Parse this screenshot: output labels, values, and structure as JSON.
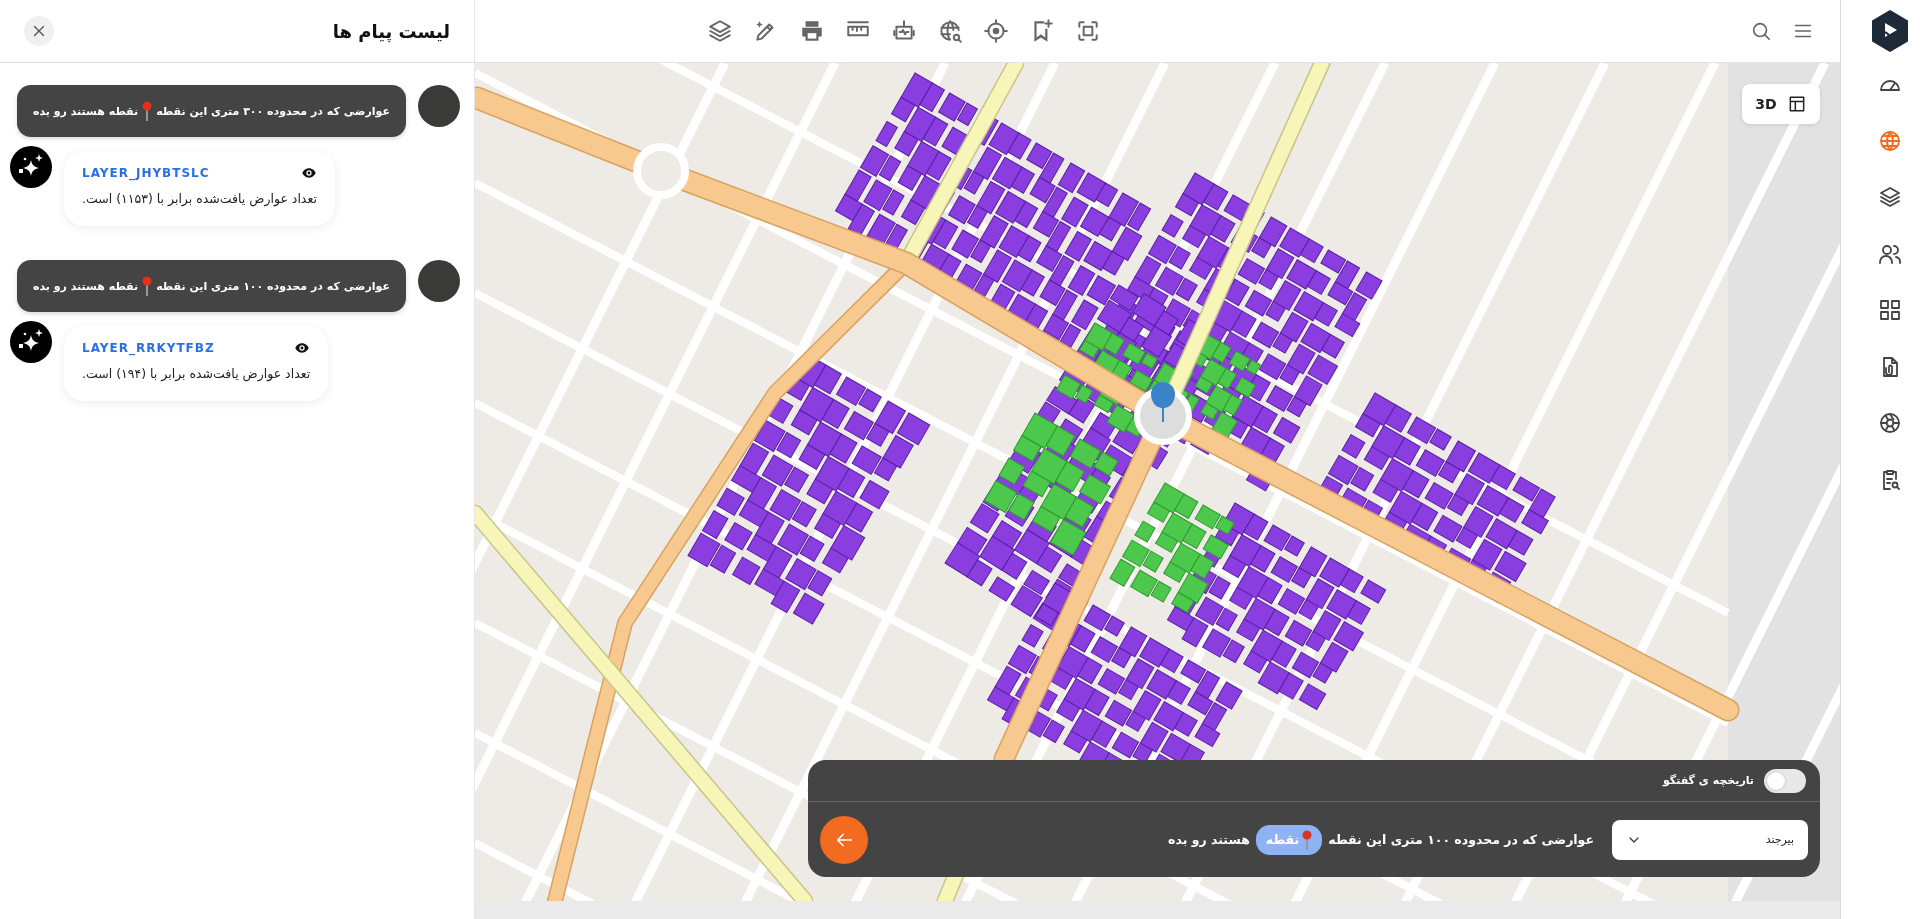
{
  "panel": {
    "title": "لیست پیام ها"
  },
  "messages": [
    {
      "kind": "user",
      "text_before": "عوارضی که در محدوده ۳۰۰ متری این نقطه",
      "text_after": "نقطه هستند رو بده"
    },
    {
      "kind": "bot",
      "layer": "LAYER_JHYBTSLC",
      "text": "تعداد عوارض یافت‌شده برابر با (۱۱۵۳) است."
    },
    {
      "kind": "user",
      "text_before": "عوارضی که در محدوده ۱۰۰ متری این نقطه",
      "text_after": "نقطه هستند رو بده"
    },
    {
      "kind": "bot",
      "layer": "LAYER_RRKYTFBZ",
      "text": "تعداد عوارض یافت‌شده برابر با (۱۹۴) است."
    }
  ],
  "map": {
    "view_button": "3D"
  },
  "chat_bar": {
    "history_label": "تاریخچه ی گفتگو",
    "history_on": false,
    "city": "بیرجند",
    "input_before": "عوارضی که در  محدوده ۱۰۰ متری این نقطه",
    "chip": "نقطه",
    "input_after": "هستند رو بده"
  },
  "sidebar": {
    "items": [
      {
        "selected": false
      },
      {
        "selected": true
      },
      {
        "selected": false
      },
      {
        "selected": false
      },
      {
        "selected": false
      },
      {
        "selected": false
      },
      {
        "selected": false
      },
      {
        "selected": false
      }
    ]
  }
}
